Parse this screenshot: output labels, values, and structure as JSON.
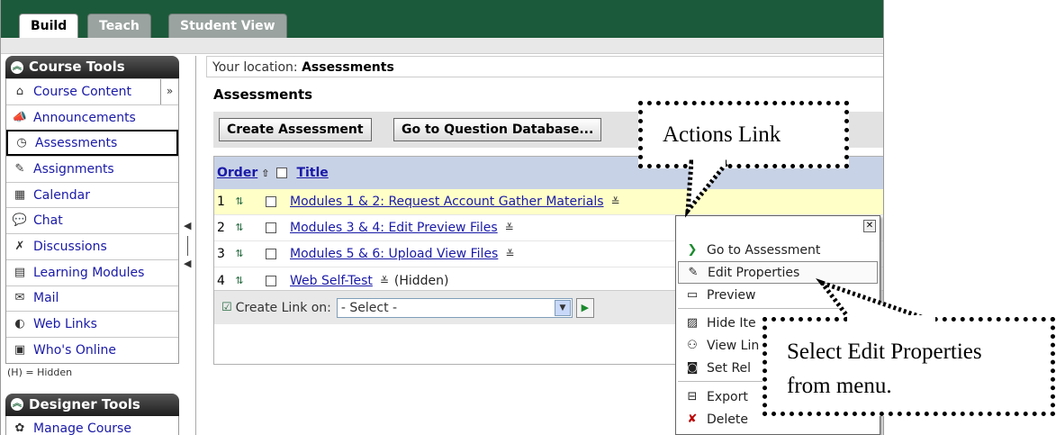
{
  "tabs": [
    {
      "label": "Build",
      "state": "active"
    },
    {
      "label": "Teach",
      "state": "inactive"
    },
    {
      "label": "Student View",
      "state": "inactive"
    }
  ],
  "sidebar": {
    "course_tools_title": "Course Tools",
    "items": [
      {
        "label": "Course Content",
        "icon": "home-icon"
      },
      {
        "label": "Announcements",
        "icon": "megaphone-icon"
      },
      {
        "label": "Assessments",
        "icon": "assessment-icon"
      },
      {
        "label": "Assignments",
        "icon": "assignment-icon"
      },
      {
        "label": "Calendar",
        "icon": "calendar-icon"
      },
      {
        "label": "Chat",
        "icon": "chat-bubble-icon"
      },
      {
        "label": "Discussions",
        "icon": "discussion-icon"
      },
      {
        "label": "Learning Modules",
        "icon": "module-icon"
      },
      {
        "label": "Mail",
        "icon": "mail-icon"
      },
      {
        "label": "Web Links",
        "icon": "web-link-icon"
      },
      {
        "label": "Who's Online",
        "icon": "people-icon"
      }
    ],
    "hidden_note": "(H) = Hidden",
    "designer_tools_title": "Designer Tools",
    "designer_items": [
      {
        "label": "Manage Course",
        "icon": "manage-course-icon"
      }
    ]
  },
  "main": {
    "location_prefix": "Your location: ",
    "location_value": "Assessments",
    "page_title": "Assessments",
    "buttons": {
      "create_assessment": "Create Assessment",
      "go_to_question_database": "Go to Question Database..."
    },
    "table": {
      "order_header": "Order",
      "title_header": "Title",
      "rows": [
        {
          "order": "1",
          "title": "Modules 1 & 2: Request Account Gather Materials",
          "suffix": ""
        },
        {
          "order": "2",
          "title": "Modules 3 & 4: Edit Preview Files",
          "suffix": ""
        },
        {
          "order": "3",
          "title": "Modules 5 & 6: Upload View Files",
          "suffix": ""
        },
        {
          "order": "4",
          "title": "Web Self-Test",
          "suffix": "(Hidden)"
        }
      ]
    },
    "create_link": {
      "label": "Create Link on:",
      "selected": "- Select -"
    }
  },
  "actions_menu": {
    "items": [
      {
        "label": "Go to Assessment",
        "icon": "arrow-right-icon"
      },
      {
        "label": "Edit Properties",
        "icon": "pencil-icon"
      },
      {
        "label": "Preview",
        "icon": "preview-icon"
      },
      {
        "label": "Hide Ite",
        "icon": "hide-icon"
      },
      {
        "label": "View Lin",
        "icon": "view-links-icon"
      },
      {
        "label": "Set Rel",
        "icon": "release-icon"
      },
      {
        "label": "Export",
        "icon": "export-icon"
      },
      {
        "label": "Delete",
        "icon": "delete-icon"
      }
    ]
  },
  "callouts": {
    "actions_link": "Actions Link",
    "select_edit_line1": "Select Edit Properties",
    "select_edit_line2": "from menu."
  },
  "colors": {
    "tab_bar": "#1b5a3a",
    "link": "#1a1aa8",
    "table_header": "#c8d2e6",
    "highlight_row": "#ffffc8"
  }
}
